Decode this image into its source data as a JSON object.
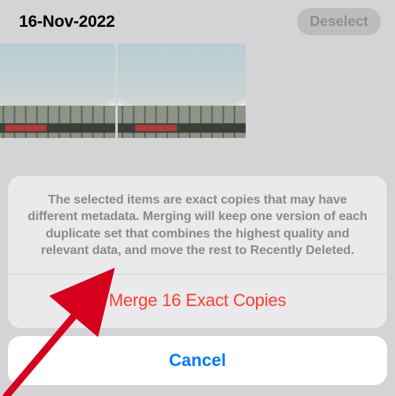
{
  "header": {
    "date_title": "16-Nov-2022",
    "deselect_label": "Deselect"
  },
  "sheet": {
    "message": "The selected items are exact copies that may have different metadata. Merging will keep one version of each duplicate set that combines the highest quality and relevant data, and move the rest to Recently Deleted.",
    "merge_label": "Merge 16 Exact Copies",
    "cancel_label": "Cancel"
  },
  "colors": {
    "destructive": "#ff3b30",
    "primary": "#007aff"
  },
  "annotation": {
    "arrow_color": "#d6001c"
  }
}
